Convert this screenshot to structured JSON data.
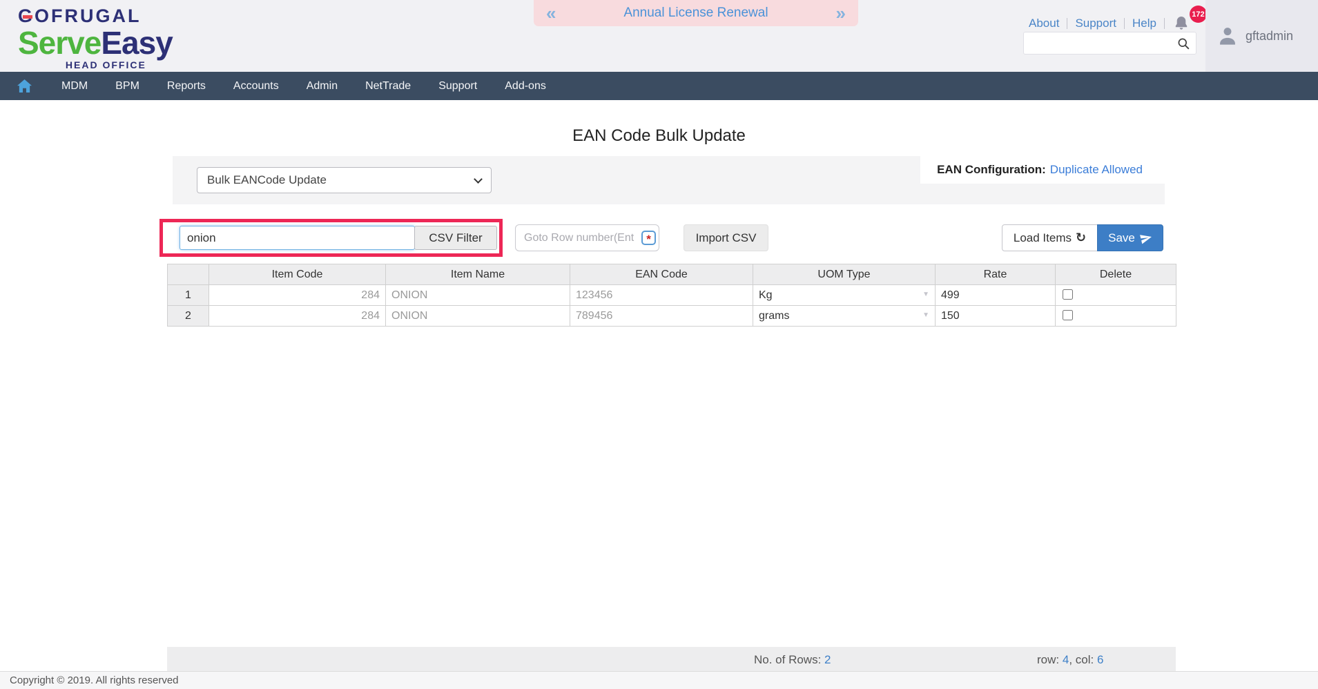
{
  "header": {
    "logo": {
      "brand": "GOFRUGAL",
      "product_serve": "Serve",
      "product_easy": "Easy",
      "tagline": "HEAD OFFICE"
    },
    "banner": {
      "text": "Annual License Renewal"
    },
    "links": [
      "About",
      "Support",
      "Help"
    ],
    "notification_count": "172",
    "username": "gftadmin"
  },
  "nav": {
    "items": [
      "MDM",
      "BPM",
      "Reports",
      "Accounts",
      "Admin",
      "NetTrade",
      "Support",
      "Add-ons"
    ]
  },
  "page": {
    "title": "EAN Code Bulk Update",
    "mode_select_value": "Bulk EANCode Update",
    "ean_config_label": "EAN Configuration:",
    "ean_config_value": "Duplicate Allowed",
    "search_value": "onion",
    "csv_filter_label": "CSV Filter",
    "goto_placeholder": "Goto Row number(Ent",
    "import_csv_label": "Import CSV",
    "load_items_label": "Load Items",
    "save_label": "Save"
  },
  "table": {
    "columns": [
      "",
      "Item Code",
      "Item Name",
      "EAN Code",
      "UOM Type",
      "Rate",
      "Delete"
    ],
    "rows": [
      {
        "num": "1",
        "item_code": "284",
        "item_name": "ONION",
        "ean_code": "123456",
        "uom": "Kg",
        "rate": "499",
        "delete_checked": false
      },
      {
        "num": "2",
        "item_code": "284",
        "item_name": "ONION",
        "ean_code": "789456",
        "uom": "grams",
        "rate": "150",
        "delete_checked": false
      }
    ]
  },
  "status": {
    "rows_label": "No. of Rows:",
    "rows_value": "2",
    "row_label": "row:",
    "row_value": "4",
    "comma": ",",
    "col_label": "col:",
    "col_value": "6"
  },
  "footer": {
    "copyright": "Copyright © 2019. All rights reserved"
  },
  "icons": {
    "banner_prev": "«",
    "banner_next": "»",
    "refresh": "↻",
    "uom_caret": "▼",
    "goto_badge": "*"
  },
  "colors": {
    "nav_background": "#3b4c61",
    "link_blue": "#4a85c7",
    "save_button_blue": "#3d7ec6",
    "highlight_red": "#ed2756",
    "banner_pink": "#f8dbde",
    "badge_red": "#e91e4e",
    "logo_navy": "#2d3076",
    "logo_green": "#4eb53f"
  }
}
